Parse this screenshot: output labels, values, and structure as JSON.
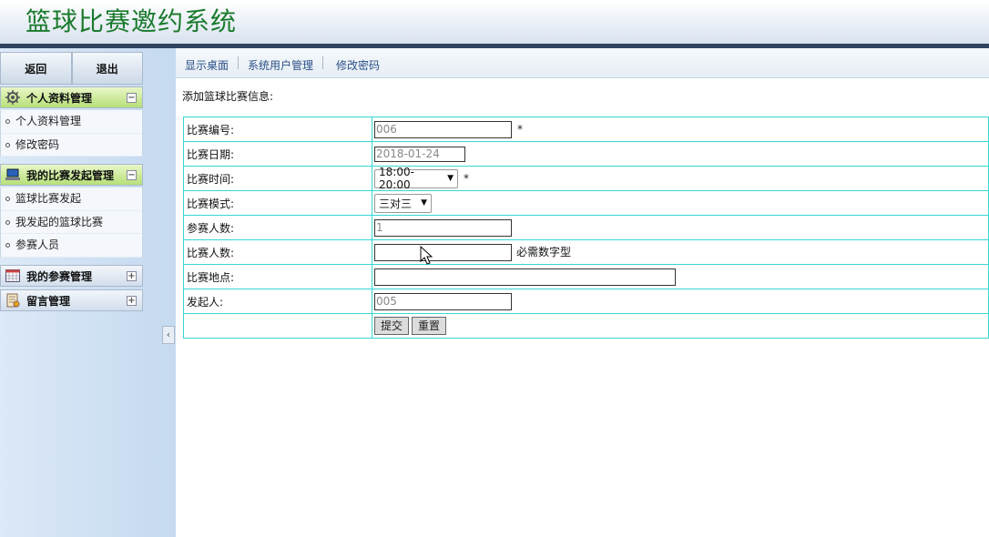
{
  "header": {
    "title": "篮球比赛邀约系统"
  },
  "sidebar": {
    "top_buttons": {
      "back": "返回",
      "logout": "退出"
    },
    "groups": [
      {
        "label": "个人资料管理",
        "toggle": "−",
        "items": [
          "个人资料管理",
          "修改密码"
        ]
      },
      {
        "label": "我的比赛发起管理",
        "toggle": "−",
        "items": [
          "篮球比赛发起",
          "我发起的篮球比赛",
          "参赛人员"
        ]
      },
      {
        "label": "我的参赛管理",
        "toggle": "+",
        "items": []
      },
      {
        "label": "留言管理",
        "toggle": "+",
        "items": []
      }
    ],
    "collapse_glyph": "‹"
  },
  "nav": {
    "links": [
      "显示桌面",
      "系统用户管理",
      "修改密码"
    ]
  },
  "page": {
    "title": "添加篮球比赛信息:"
  },
  "form": {
    "match_no": {
      "label": "比赛编号:",
      "value": "006",
      "required": "*"
    },
    "match_date": {
      "label": "比赛日期:",
      "value": "2018-01-24"
    },
    "match_time": {
      "label": "比赛时间:",
      "value": "18:00-20:00",
      "required": "*"
    },
    "match_mode": {
      "label": "比赛模式:",
      "value": "三对三"
    },
    "participants": {
      "label": "参赛人数:",
      "value": "1"
    },
    "match_count": {
      "label": "比赛人数:",
      "value": "",
      "hint": "必需数字型"
    },
    "location": {
      "label": "比赛地点:",
      "value": ""
    },
    "initiator": {
      "label": "发起人:",
      "value": "005"
    },
    "buttons": {
      "submit": "提交",
      "reset": "重置"
    }
  }
}
